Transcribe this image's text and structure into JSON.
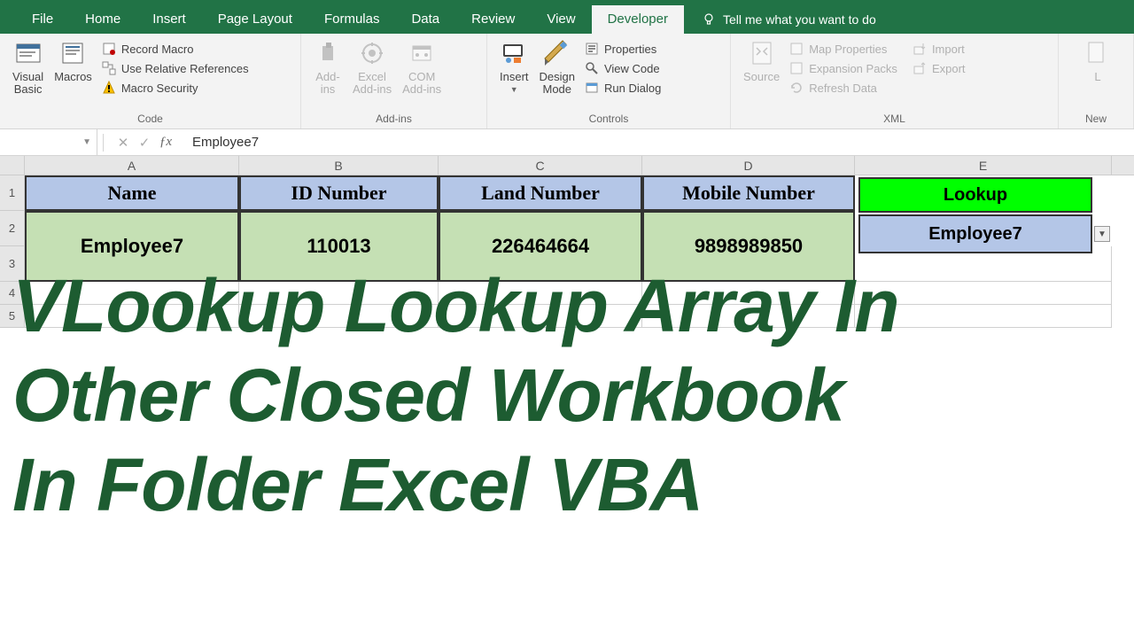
{
  "tabs": [
    "File",
    "Home",
    "Insert",
    "Page Layout",
    "Formulas",
    "Data",
    "Review",
    "View",
    "Developer"
  ],
  "active_tab": "Developer",
  "tell_me": "Tell me what you want to do",
  "ribbon": {
    "code": {
      "visual_basic": "Visual\nBasic",
      "macros": "Macros",
      "record": "Record Macro",
      "relative": "Use Relative References",
      "security": "Macro Security",
      "label": "Code"
    },
    "addins": {
      "addins": "Add-\nins",
      "excel": "Excel\nAdd-ins",
      "com": "COM\nAdd-ins",
      "label": "Add-ins"
    },
    "controls": {
      "insert": "Insert",
      "design": "Design\nMode",
      "properties": "Properties",
      "view_code": "View Code",
      "run_dialog": "Run Dialog",
      "label": "Controls"
    },
    "xml": {
      "source": "Source",
      "map_props": "Map Properties",
      "expansion": "Expansion Packs",
      "refresh": "Refresh Data",
      "import": "Import",
      "export": "Export",
      "label": "XML"
    },
    "new": {
      "label": "New"
    }
  },
  "name_box": "",
  "formula": "Employee7",
  "columns": [
    "A",
    "B",
    "C",
    "D",
    "E"
  ],
  "rows": [
    "1",
    "2",
    "3",
    "4",
    "5"
  ],
  "headers": [
    "Name",
    "ID Number",
    "Land Number",
    "Mobile Number"
  ],
  "data_row": [
    "Employee7",
    "110013",
    "226464664",
    "9898989850"
  ],
  "lookup": {
    "button": "Lookup",
    "value": "Employee7"
  },
  "overlay": "VLookup Lookup Array In\nOther Closed Workbook\nIn Folder Excel VBA"
}
